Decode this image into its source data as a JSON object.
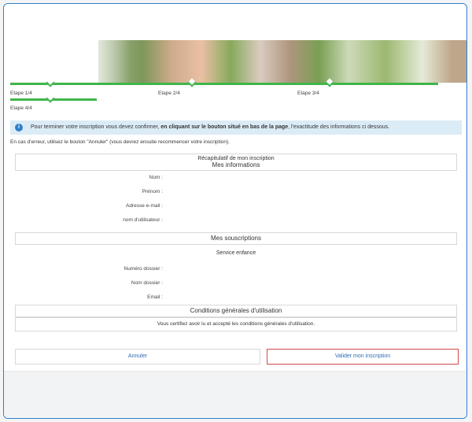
{
  "steps": [
    {
      "label": "Etape 1/4"
    },
    {
      "label": "Etape 2/4"
    },
    {
      "label": "Etape 3/4"
    },
    {
      "label": "Etape 4/4"
    }
  ],
  "info": {
    "icon": "info-circle-icon",
    "text_before": "Pour terminer votre inscription vous devez confirmer, ",
    "text_bold": "en cliquant sur le bouton situé en bas de la page",
    "text_after": ", l'exactitude des informations ci dessous."
  },
  "error_note": "En cas d'erreur, utilisez le bouton \"Annuler\" (vous devrez ensuite recommencer votre inscription).",
  "summary": {
    "title": "Récapitulatif de mon inscription",
    "my_info_header": "Mes informations",
    "fields": [
      {
        "label": "Nom :",
        "value": ""
      },
      {
        "label": "Prénom :",
        "value": ""
      },
      {
        "label": "Adresse e-mail :",
        "value": ""
      },
      {
        "label": "nom d'utilisateur :",
        "value": ""
      }
    ],
    "subscriptions_header": "Mes souscriptions",
    "service_title": "Service enfance",
    "service_fields": [
      {
        "label": "Numéro dossier :",
        "value": ""
      },
      {
        "label": "Nom dossier :",
        "value": ""
      },
      {
        "label": "Email :",
        "value": ""
      }
    ],
    "cgu_header": "Conditions générales d'utilisation",
    "cgu_text": "Vous certifiez avoir lu et accepté les conditions générales d'utilisation."
  },
  "buttons": {
    "cancel": "Annuler",
    "validate": "Valider mon inscription"
  },
  "colors": {
    "accent": "#2f80c9",
    "step_green": "#3fb54a",
    "validate_border": "#d14a4a"
  }
}
